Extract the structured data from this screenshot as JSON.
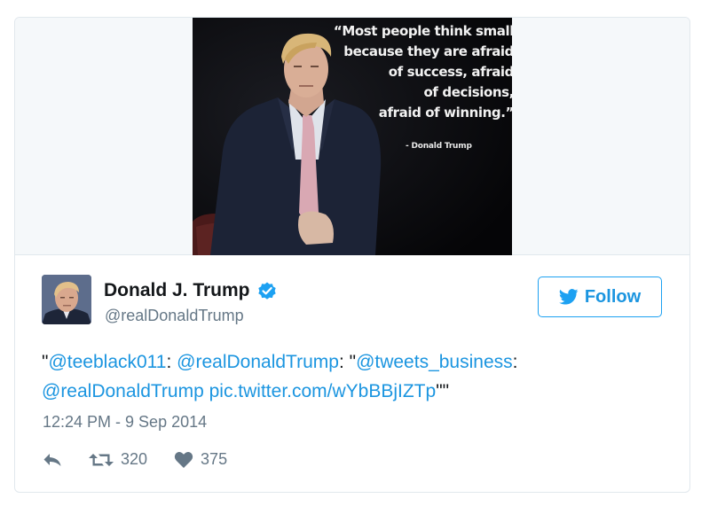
{
  "tweet": {
    "image_quote": {
      "lines": [
        "“Most people think small",
        "because they are afraid",
        "of success, afraid",
        "of decisions,",
        "afraid of winning.”"
      ],
      "attribution": "- Donald Trump"
    },
    "author": {
      "name": "Donald J. Trump",
      "handle": "@realDonaldTrump",
      "verified": true,
      "verified_icon": "verified-badge-icon"
    },
    "follow_button": {
      "label": "Follow",
      "icon": "twitter-bird-icon"
    },
    "text": {
      "quote_open": "\"",
      "mention1": "@teeblack011",
      "sep1": ": ",
      "mention2": "@realDonaldTrump",
      "sep2": ": \"",
      "mention3": "@tweets_business",
      "sep3": ":",
      "mention4": "@realDonaldTrump",
      "space": " ",
      "link": "pic.twitter.com/wYbBBjIZTp",
      "quote_close": "\"\""
    },
    "timestamp": "12:24 PM - 9 Sep 2014",
    "actions": {
      "reply_icon": "reply-icon",
      "retweet_icon": "retweet-icon",
      "retweet_count": "320",
      "like_icon": "heart-icon",
      "like_count": "375"
    },
    "colors": {
      "link": "#1b95e0",
      "muted": "#657786",
      "text": "#14171a",
      "border": "#e1e8ed"
    }
  }
}
